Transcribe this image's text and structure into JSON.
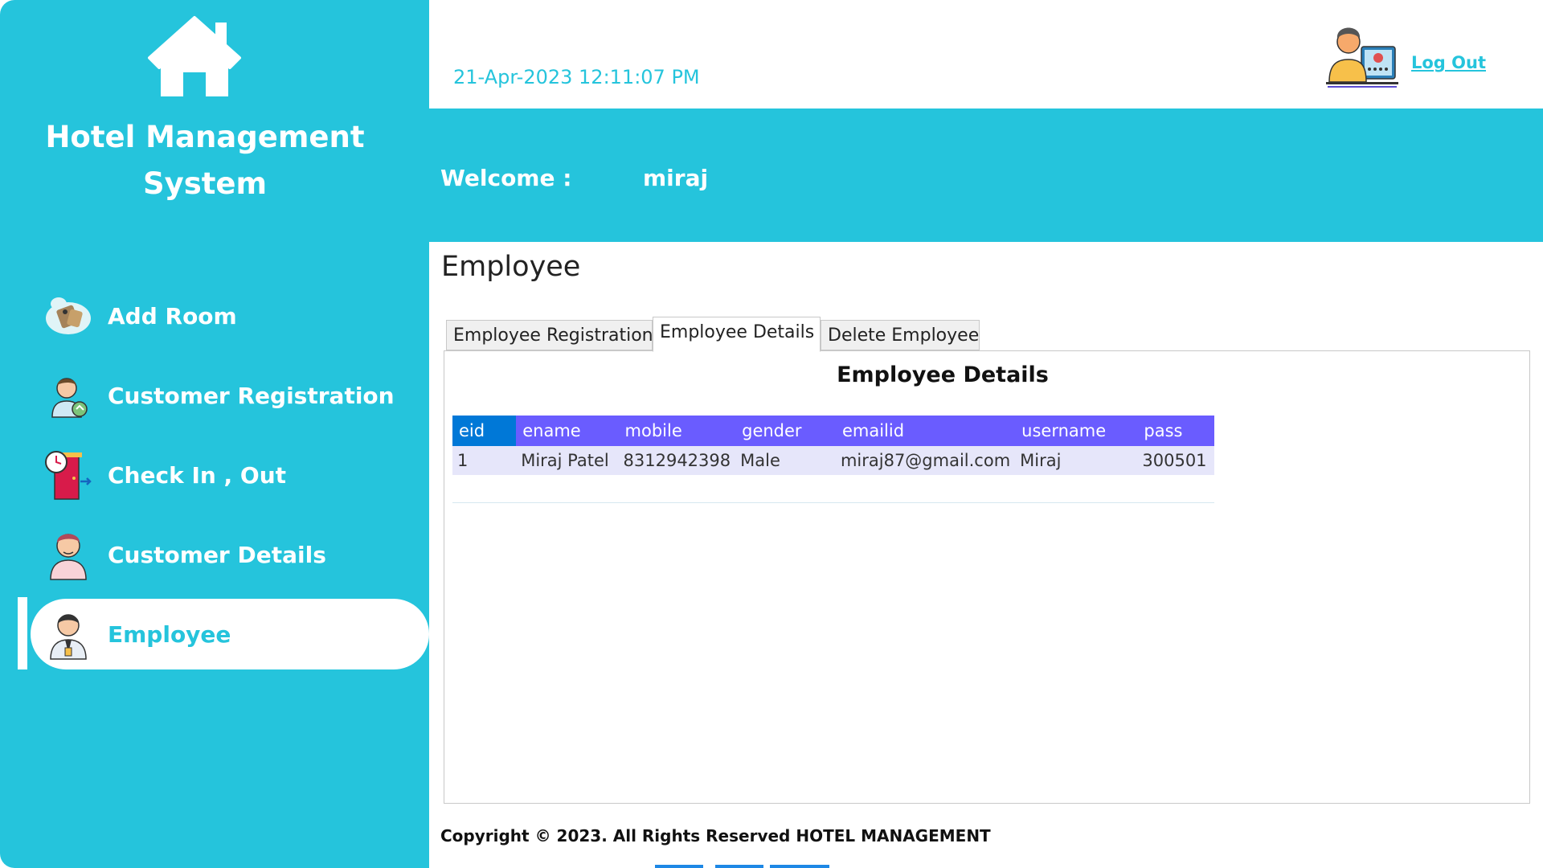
{
  "app": {
    "title": "Hotel Management System"
  },
  "sidebar": {
    "items": [
      {
        "label": "Add Room",
        "icon": "room-key-icon"
      },
      {
        "label": "Customer Registration",
        "icon": "customer-register-icon"
      },
      {
        "label": "Check In , Out",
        "icon": "door-clock-icon"
      },
      {
        "label": "Customer Details",
        "icon": "customer-icon"
      },
      {
        "label": "Employee",
        "icon": "employee-icon"
      }
    ],
    "active": "Employee"
  },
  "header": {
    "datetime": "21-Apr-2023 12:11:07 PM",
    "logout_label": "Log Out",
    "welcome_label": "Welcome :",
    "username": "miraj"
  },
  "main": {
    "page_title": "Employee",
    "tabs": [
      {
        "label": "Employee Registration"
      },
      {
        "label": "Employee Details"
      },
      {
        "label": "Delete Employee"
      }
    ],
    "active_tab": "Employee Details",
    "panel_title": "Employee Details",
    "table": {
      "columns": [
        "eid",
        "ename",
        "mobile",
        "gender",
        "emailid",
        "username",
        "pass"
      ],
      "rows": [
        [
          "1",
          "Miraj Patel",
          "8312942398",
          "Male",
          "miraj87@gmail.com",
          "Miraj",
          "300501"
        ]
      ]
    }
  },
  "footer": {
    "text": "Copyright © 2023. All Rights Reserved HOTEL MANAGEMENT"
  },
  "colors": {
    "accent": "#25c4dc",
    "table_header": "#6a5cff",
    "table_header_first": "#0078d7",
    "table_row": "#e6e6fa"
  }
}
